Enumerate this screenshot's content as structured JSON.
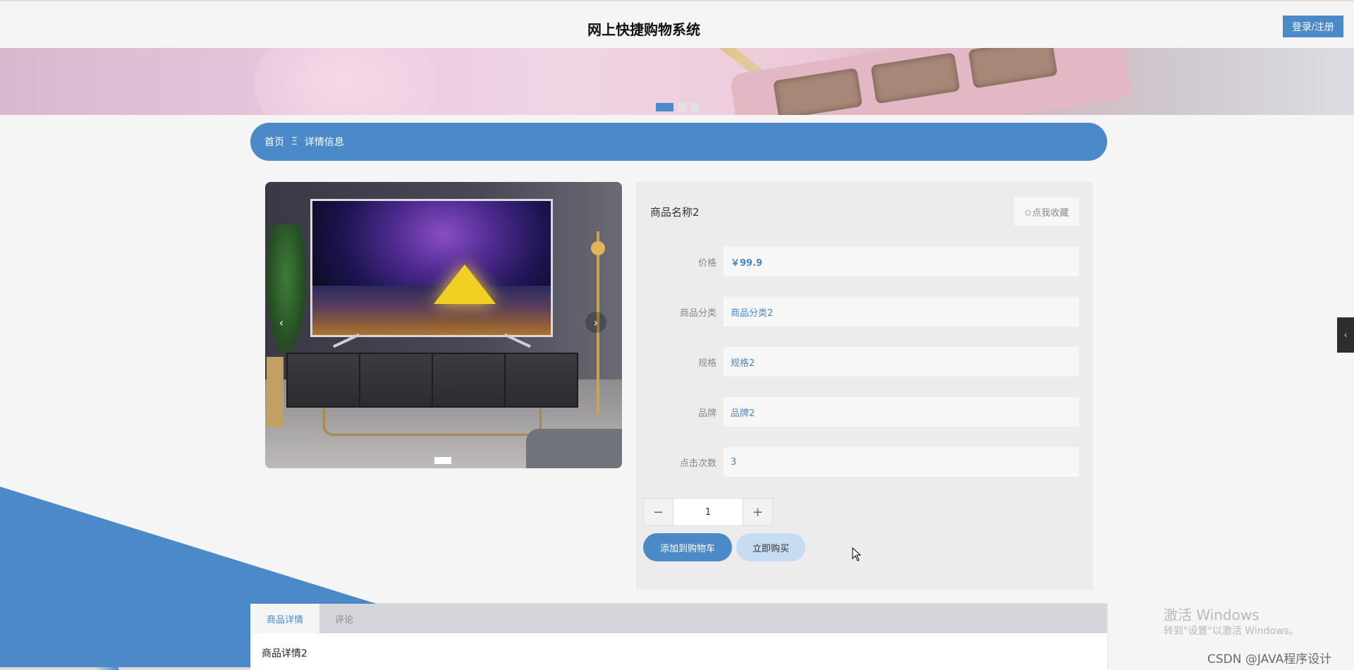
{
  "header": {
    "title": "网上快捷购物系统",
    "login_label": "登录/注册"
  },
  "breadcrumb": {
    "home": "首页",
    "separator": "Ξ",
    "current": "详情信息"
  },
  "product": {
    "name": "商品名称2",
    "favorite_label": "✩点我收藏",
    "fields": [
      {
        "label": "价格",
        "value": "￥99.9"
      },
      {
        "label": "商品分类",
        "value": "商品分类2"
      },
      {
        "label": "规格",
        "value": "规格2"
      },
      {
        "label": "品牌",
        "value": "品牌2"
      },
      {
        "label": "点击次数",
        "value": "3"
      }
    ],
    "quantity": "1",
    "minus_label": "−",
    "plus_label": "+",
    "add_to_cart_label": "添加到购物车",
    "buy_now_label": "立即购买"
  },
  "tabs": {
    "items": [
      {
        "label": "商品详情"
      },
      {
        "label": "评论"
      }
    ],
    "content": "商品详情2"
  },
  "watermark": {
    "line1": "激活 Windows",
    "line2": "转到\"设置\"以激活 Windows。",
    "csdn": "CSDN @JAVA程序设计"
  },
  "icons": {
    "prev": "‹",
    "next": "›",
    "side_handle": "‹"
  },
  "colors": {
    "accent": "#4b89c8",
    "accent_light": "#c6dcf3"
  }
}
